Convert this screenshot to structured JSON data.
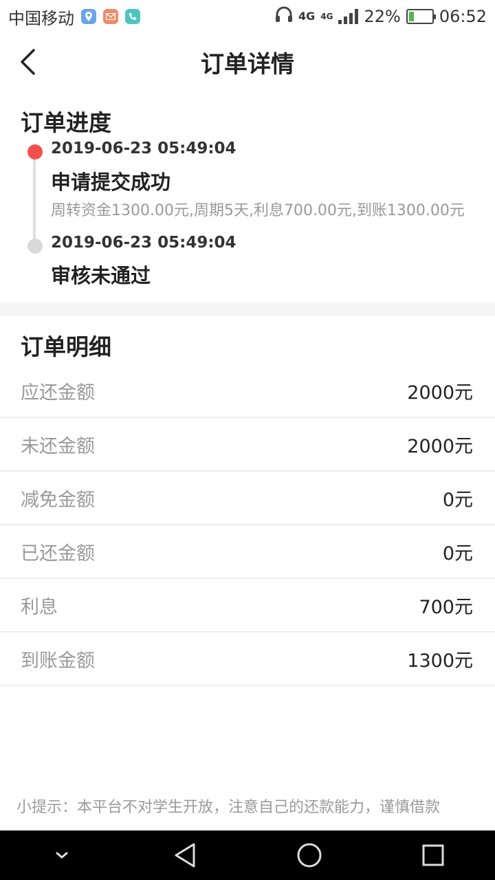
{
  "status_bar": {
    "carrier": "中国移动",
    "network_a": "4G",
    "network_b": "4G",
    "battery": "22%",
    "battery_level": 0.22,
    "time": "06:52",
    "icons": [
      "location-icon",
      "mail-icon",
      "phone-icon",
      "headphones-icon",
      "signal-icon",
      "battery-icon"
    ]
  },
  "header": {
    "title": "订单详情",
    "back_icon": "back-chevron-icon"
  },
  "progress": {
    "title": "订单进度",
    "items": [
      {
        "time": "2019-06-23 05:49:04",
        "status": "申请提交成功",
        "desc": "周转资金1300.00元,周期5天,利息700.00元,到账1300.00元",
        "dot_color": "#f0504d"
      },
      {
        "time": "2019-06-23 05:49:04",
        "status": "审核未通过",
        "desc": "",
        "dot_color": "#d9d9d9"
      }
    ]
  },
  "details": {
    "title": "订单明细",
    "rows": [
      {
        "label": "应还金额",
        "value": "2000元"
      },
      {
        "label": "未还金额",
        "value": "2000元"
      },
      {
        "label": "减免金额",
        "value": "0元"
      },
      {
        "label": "已还金额",
        "value": "0元"
      },
      {
        "label": "利息",
        "value": "700元"
      },
      {
        "label": "到账金额",
        "value": "1300元"
      }
    ]
  },
  "tip": "小提示：本平台不对学生开放，注意自己的还款能力，谨慎借款",
  "nav": {
    "icons": [
      "nav-down-icon",
      "nav-back-icon",
      "nav-home-icon",
      "nav-recents-icon"
    ]
  },
  "colors": {
    "accent_red": "#f0504d",
    "text_gray": "#999999",
    "divider": "#ececec"
  }
}
